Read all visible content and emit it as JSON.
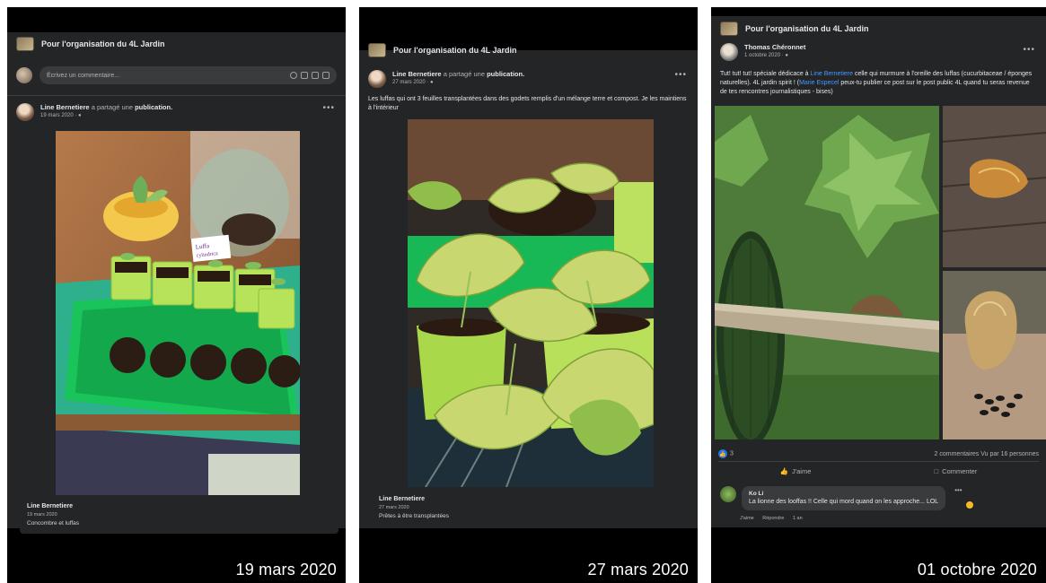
{
  "panel1": {
    "group_name": "Pour l'organisation du 4L Jardin",
    "comment_placeholder": "Écrivez un commentaire...",
    "author": "Line Bernetiere",
    "action_text": "a partagé une",
    "action_object": "publication.",
    "date": "19 mars 2020",
    "shared_author": "Line Bernetiere",
    "shared_date": "19 mars 2020",
    "shared_text": "Concombre et luffas",
    "plant_label": "Luffa\ncylindrica",
    "caption": "19 mars 2020"
  },
  "panel2": {
    "group_name": "Pour l'organisation du 4L Jardin",
    "author": "Line Bernetiere",
    "action_text": "a partagé une",
    "action_object": "publication.",
    "date": "27 mars 2020",
    "post_text": "Les luffas qui ont 3 feuilles transplantées dans des godets remplis d'un mélange terre et compost. Je les maintiens à l'intérieur",
    "shared_author": "Line Bernetiere",
    "shared_date": "27 mars 2020",
    "shared_text": "Prêtes à être transplantées",
    "caption": "27 mars 2020"
  },
  "panel3": {
    "group_name": "Pour l'organisation du 4L Jardin",
    "author": "Thomas Chéronnet",
    "date": "1 octobre 2020",
    "post_text_1": "Tut! tut! tut! spéciale dédicace à ",
    "mention_1": "Line Bernetiere",
    "post_text_2": " celle qui murmure à l'oreille des luffas (cucurbitaceae / éponges naturelles). 4L jardin spirit ! (",
    "mention_2": "Marie Especel",
    "post_text_3": " peux-tu publier ce post sur le post public 4L quand tu seras revenue de tes rencontres journalistiques - bises)",
    "likes": "3",
    "stats": "2 commentaires  Vu par 16 personnes",
    "like_label": "J'aime",
    "comment_label": "Commenter",
    "reply_name": "Ko Li",
    "reply_text": "La lionne des looffas !! Celle qui mord quand on les approche... LOL",
    "reply_like": "J'aime",
    "reply_reply": "Répondre",
    "reply_time": "1 an",
    "caption": "01 octobre 2020"
  },
  "colors": {
    "facebook_bg": "#242526",
    "link": "#4599ff",
    "like": "#2078f4"
  }
}
